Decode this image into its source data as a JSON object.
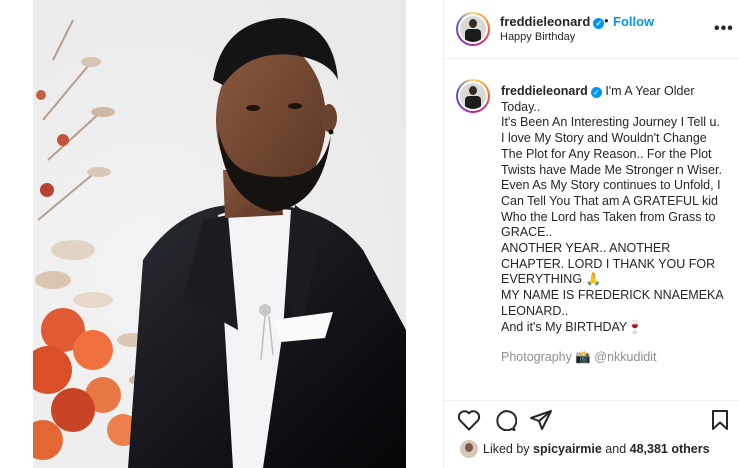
{
  "post": {
    "username": "freddieleonard",
    "verified_glyph": "✓",
    "separator": "•",
    "follow_label": "Follow",
    "location": "Happy Birthday",
    "more_icon": "more-options-icon",
    "more_glyph": "•••"
  },
  "caption": {
    "username": "freddieleonard",
    "lines": [
      "I'm A Year Older Today..",
      "It's Been An Interesting Journey I Tell u.",
      "I love My Story and Wouldn't Change The Plot for Any Reason.. For the Plot Twists have Made Me Stronger n Wiser.",
      "Even As My Story continues to Unfold, I Can Tell You That am A GRATEFUL kid Who the Lord has Taken from Grass to GRACE..",
      "ANOTHER YEAR.. ANOTHER CHAPTER. LORD I THANK YOU FOR EVERYTHING 🙏",
      "MY NAME IS FREDERICK NNAEMEKA LEONARD..",
      "And it's My BIRTHDAY🍷",
      "Photography 📸 @nkkudidit"
    ]
  },
  "actions": {
    "like_icon": "heart-icon",
    "comment_icon": "comment-icon",
    "share_icon": "share-icon",
    "save_icon": "bookmark-icon"
  },
  "likes": {
    "prefix": "Liked by ",
    "liker": "spicyairmie",
    "middle": " and ",
    "count": "48,381 others"
  },
  "colors": {
    "accent": "#0095f6",
    "text": "#262626",
    "border": "#efefef"
  }
}
